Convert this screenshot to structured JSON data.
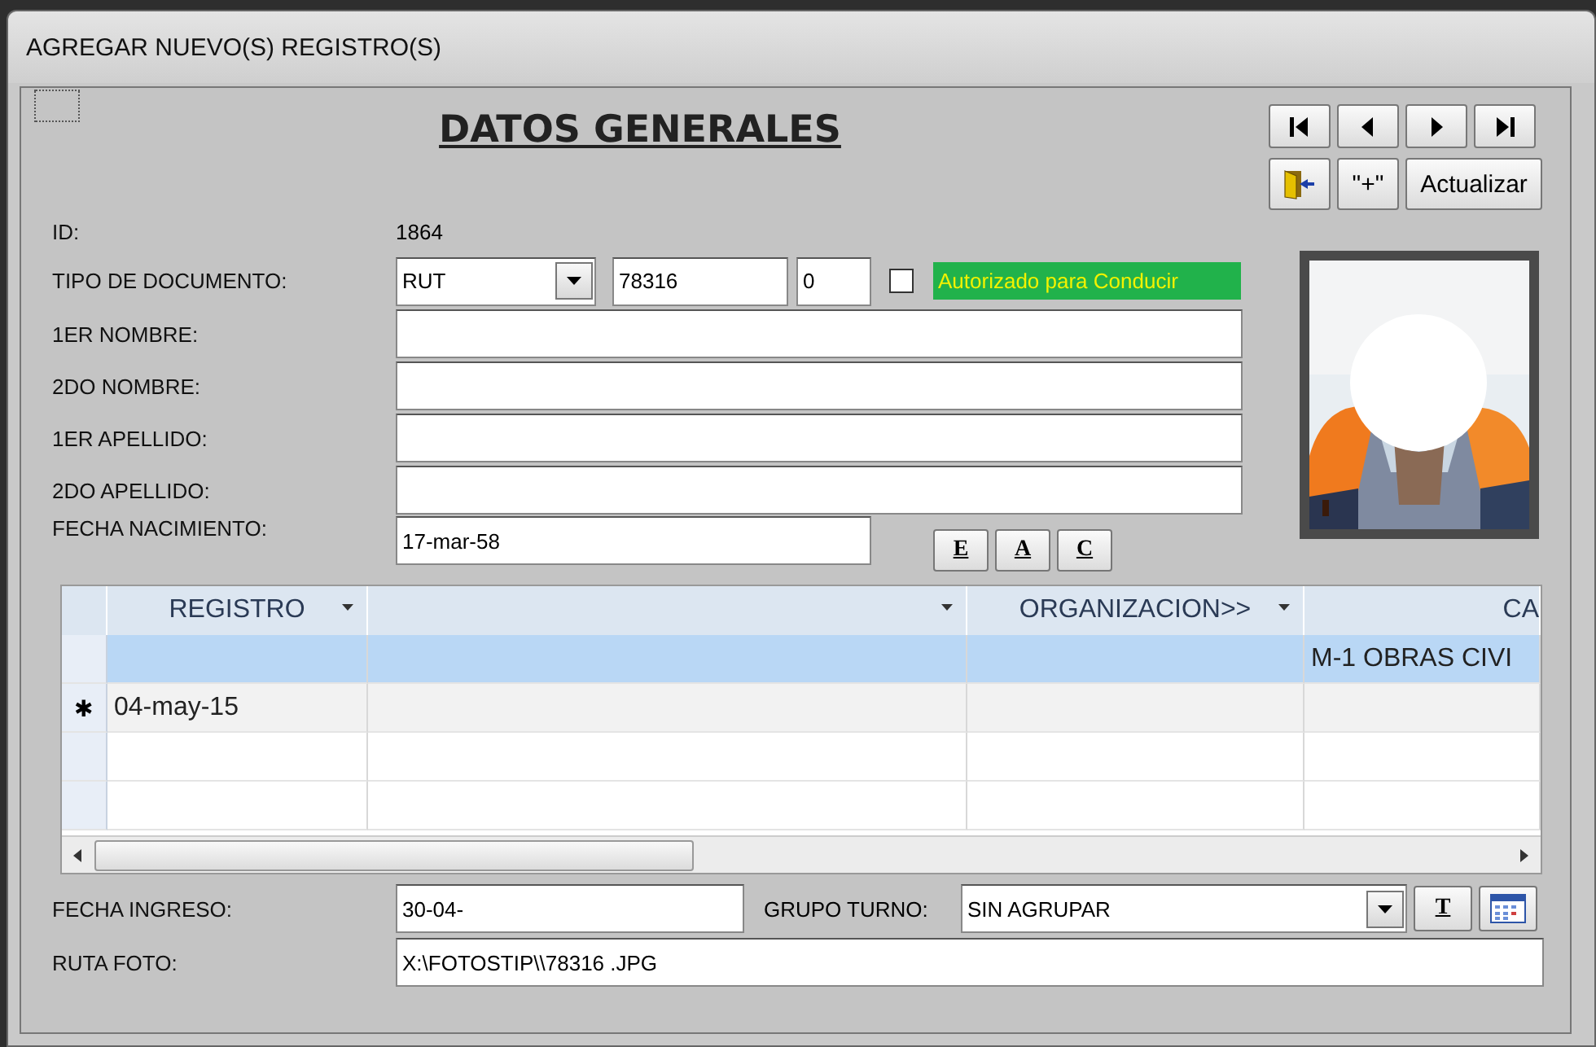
{
  "window": {
    "title": "AGREGAR NUEVO(S) REGISTRO(S)"
  },
  "heading": "DATOS GENERALES",
  "nav_buttons": [
    {
      "kind": "first"
    },
    {
      "kind": "prev"
    },
    {
      "kind": "next"
    },
    {
      "kind": "last"
    }
  ],
  "action_buttons": [
    {
      "kind": "exit"
    },
    {
      "kind": "text",
      "label": "\"+\""
    },
    {
      "kind": "text",
      "label": "Actualizar"
    }
  ],
  "fields": [
    {
      "kind": "static",
      "label": "ID:",
      "value": "1864"
    },
    {
      "kind": "document",
      "label": "TIPO DE DOCUMENTO:",
      "value": "RUT",
      "number": "78316",
      "check_digit": "0",
      "authorized": {
        "label": "Autorizado para Conducir",
        "checked": false
      }
    },
    {
      "kind": "text",
      "label": "1ER NOMBRE:"
    },
    {
      "kind": "text",
      "label": "2DO NOMBRE:"
    },
    {
      "kind": "text",
      "label": "1ER APELLIDO:"
    },
    {
      "kind": "text",
      "label": "2DO APELLIDO:"
    },
    {
      "kind": "date",
      "label": "FECHA NACIMIENTO:",
      "value": "17-mar-58"
    }
  ],
  "format_buttons": [
    "E",
    "A",
    "C"
  ],
  "photo": {
    "kind": "picture"
  },
  "grid": {
    "columns": [
      {
        "label": "REGISTRO",
        "dropdown": true
      },
      {
        "dropdown": true
      },
      {
        "label": "ORGANIZACION>>",
        "dropdown": true
      },
      {
        "label": "CA",
        "dropdown": false
      }
    ],
    "rows": [
      {
        "selected": true,
        "cells": [
          null,
          null,
          null,
          "M-1 OBRAS CIVI"
        ]
      },
      {
        "selected": false,
        "marker": "✱",
        "cells": [
          "04-may-15",
          null,
          null,
          null
        ]
      }
    ]
  },
  "fecha_ingreso": {
    "label": "FECHA INGRESO:",
    "value": "30-04-"
  },
  "grupo_turno": {
    "label": "GRUPO TURNO:",
    "value": "SIN AGRUPAR",
    "button": "T"
  },
  "ruta_foto": {
    "label": "RUTA FOTO:",
    "value": "X:\\FOTOSTIP\\\\78316   .JPG"
  }
}
